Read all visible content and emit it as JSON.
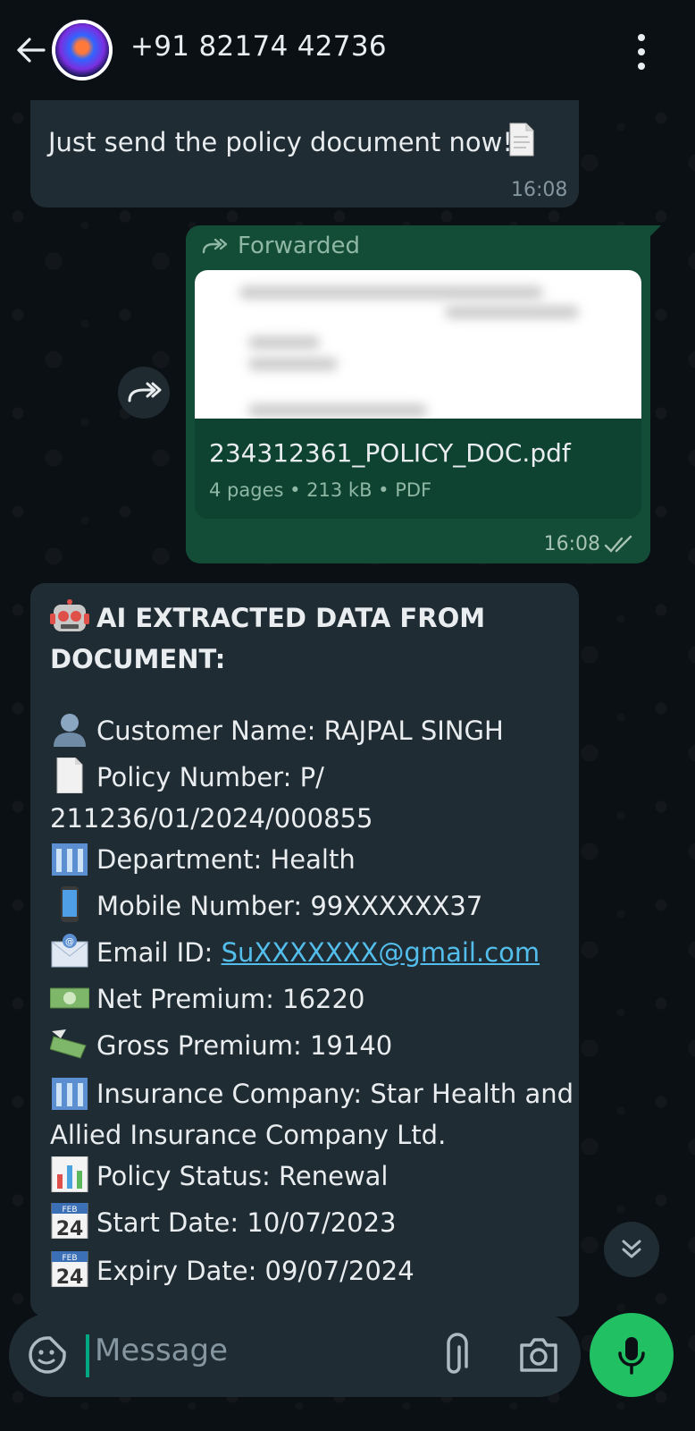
{
  "header": {
    "contact_name": "+91 82174 42736",
    "back_icon": "arrow-left-icon",
    "avatar_icon": "contact-avatar",
    "menu_icon": "more-vert-icon"
  },
  "messages": {
    "incoming_text": {
      "text": "Just send the policy document now!",
      "emoji": "page-facing-up",
      "time": "16:08"
    },
    "outgoing_doc": {
      "forwarded_label": "Forwarded",
      "file_name": "234312361_POLICY_DOC.pdf",
      "file_meta": "4 pages • 213 kB • PDF",
      "time": "16:08",
      "status": "delivered-double-tick"
    },
    "ai_message": {
      "title": "AI EXTRACTED DATA FROM DOCUMENT:",
      "title_emoji": "robot-face",
      "fields": [
        {
          "emoji": "bust-in-silhouette",
          "text": "Customer Name: RAJPAL SINGH"
        },
        {
          "emoji": "page-facing-up",
          "text_line1": "Policy Number: P/",
          "text_line2": "211236/01/2024/000855"
        },
        {
          "emoji": "office-building",
          "text": "Department: Health"
        },
        {
          "emoji": "mobile-phone",
          "text": "Mobile Number: 99XXXXXX37"
        },
        {
          "emoji": "envelope-with-arrow",
          "label": "Email ID: ",
          "link": "SuXXXXXXX@gmail.com"
        },
        {
          "emoji": "dollar-banknote",
          "text": "Net Premium: 16220"
        },
        {
          "emoji": "money-with-wings",
          "text": "Gross Premium: 19140"
        },
        {
          "emoji": "office-building",
          "text_line1": "Insurance Company: Star Health and",
          "text_line2": "Allied Insurance Company Ltd."
        },
        {
          "emoji": "bar-chart",
          "text": "Policy Status: Renewal"
        },
        {
          "emoji": "calendar",
          "calendar_month": "FEB",
          "calendar_day": "24",
          "text": "Start Date: 10/07/2023"
        },
        {
          "emoji": "calendar",
          "calendar_month": "FEB",
          "calendar_day": "24",
          "text": "Expiry Date: 09/07/2024"
        }
      ]
    }
  },
  "composer": {
    "placeholder": "Message",
    "emoji_icon": "sticker-smiley-icon",
    "attach_icon": "paperclip-icon",
    "camera_icon": "camera-icon",
    "mic_icon": "microphone-icon"
  },
  "colors": {
    "background": "#0b1014",
    "incoming_bubble": "#202c33",
    "outgoing_bubble": "#144d37",
    "accent_green": "#21c063",
    "link": "#53bdeb"
  }
}
